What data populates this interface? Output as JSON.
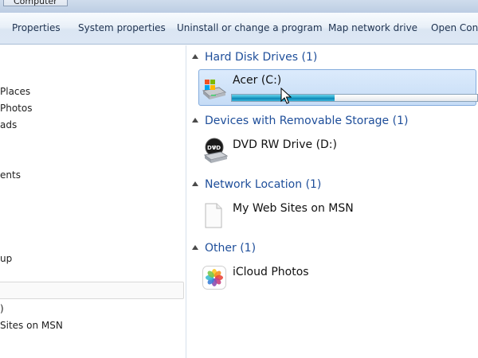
{
  "window": {
    "breadcrumb": "Computer"
  },
  "toolbar": {
    "items": [
      "Properties",
      "System properties",
      "Uninstall or change a program",
      "Map network drive",
      "Open Cont"
    ]
  },
  "nav": {
    "items": [
      "Places",
      "Photos",
      "ads",
      "ents",
      "up",
      "",
      ")",
      "Sites on MSN"
    ]
  },
  "groups": [
    {
      "header": "Hard Disk Drives (1)",
      "items": [
        {
          "label": "Acer (C:)",
          "icon": "windows-drive-icon",
          "used_fraction": 0.42
        }
      ]
    },
    {
      "header": "Devices with Removable Storage (1)",
      "items": [
        {
          "label": "DVD RW Drive (D:)",
          "icon": "dvd-drive-icon"
        }
      ]
    },
    {
      "header": "Network Location (1)",
      "items": [
        {
          "label": "My Web Sites on MSN",
          "icon": "blank-document-icon"
        }
      ]
    },
    {
      "header": "Other (1)",
      "items": [
        {
          "label": "iCloud Photos",
          "icon": "icloud-photos-icon"
        }
      ]
    }
  ],
  "colors": {
    "group_header": "#1e4e9a",
    "capacity_fill": "#1f9cc7",
    "selection": "#cfe2f8"
  }
}
